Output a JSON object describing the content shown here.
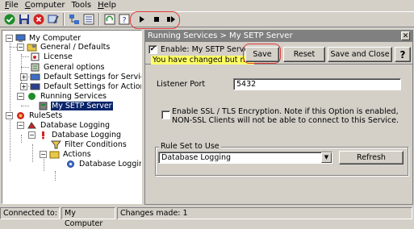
{
  "menubar": {
    "items": [
      {
        "label": "File",
        "accel": "F",
        "rest": "ile"
      },
      {
        "label": "Computer",
        "accel": "C",
        "rest": "omputer"
      },
      {
        "label": "Tools",
        "accel": "",
        "rest": "Tools"
      },
      {
        "label": "Help",
        "accel": "H",
        "rest": "elp"
      }
    ]
  },
  "toolbar": {
    "buttons": [
      "check-icon",
      "save-disk-icon",
      "stop-red-icon",
      "wizard-icon",
      "network-icon",
      "list-icon",
      "refresh-icon",
      "help-icon"
    ],
    "playback": [
      "play-icon",
      "stop-icon",
      "step-icon"
    ]
  },
  "tree": {
    "root": "My Computer",
    "general": "General / Defaults",
    "license": "License",
    "general_options": "General options",
    "default_services": "Default Settings for Services",
    "default_actions": "Default Settings for Actions",
    "running_services": "Running Services",
    "my_setp_server": "My SETP Server",
    "rulesets": "RuleSets",
    "database_logging": "Database Logging",
    "database_logging_child": "Database Logging",
    "filter_conditions": "Filter Conditions",
    "actions": "Actions",
    "database_logging_action": "Database Logging"
  },
  "panel": {
    "caption": "Running Services > My SETP Server",
    "enable_label": "Enable: My SETP Server",
    "enable_checked": true,
    "warning": "You have changed but not",
    "save_label": "Save",
    "reset_label": "Reset",
    "save_close_label": "Save and Close",
    "help_label": "?",
    "listener_port_label": "Listener Port",
    "listener_port_value": "5432",
    "ssl_label": "Enable SSL / TLS Encryption. Note if this Option is enabled, NON-SSL Clients will not be able to connect to this Service.",
    "ssl_checked": false,
    "ruleset_group_label": "Rule Set to Use",
    "ruleset_value": "Database Logging",
    "refresh_label": "Refresh"
  },
  "statusbar": {
    "connected_label": "Connected to:",
    "computer": "My Computer",
    "changes": "Changes made: 1"
  },
  "colors": {
    "face": "#d4d0c8",
    "selection": "#0a246a",
    "warning_bg": "#ffff66",
    "annotation_ring": "#e23a3a"
  }
}
